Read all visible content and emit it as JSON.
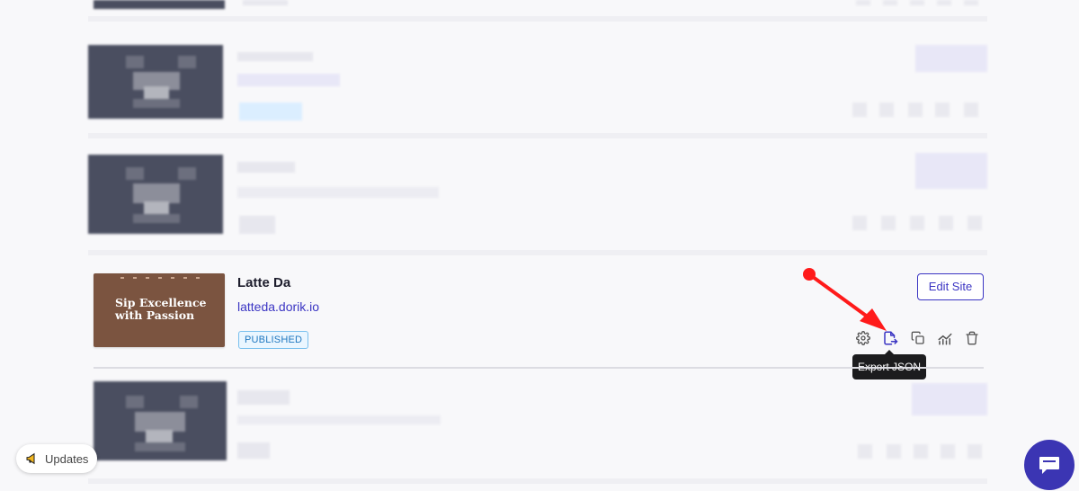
{
  "site": {
    "title": "Latte Da",
    "url": "latteda.dorik.io",
    "status_badge": "PUBLISHED",
    "edit_button": "Edit Site",
    "thumbnail_text_line1": "Sip Excellence",
    "thumbnail_text_line2": "with Passion"
  },
  "actions": {
    "icons": [
      "gear-icon",
      "export-json-icon",
      "copy-icon",
      "analytics-icon",
      "trash-icon"
    ],
    "tooltip": "Export JSON"
  },
  "annotation": {
    "color": "#ff1a1a"
  },
  "footer": {
    "updates_label": "Updates"
  },
  "colors": {
    "accent": "#3b35c3",
    "badge_blue": "#2078c0",
    "tooltip_bg": "#1c1c1e",
    "chat_bubble": "#3b35b3",
    "thumbnail_brown": "#7b5440"
  }
}
